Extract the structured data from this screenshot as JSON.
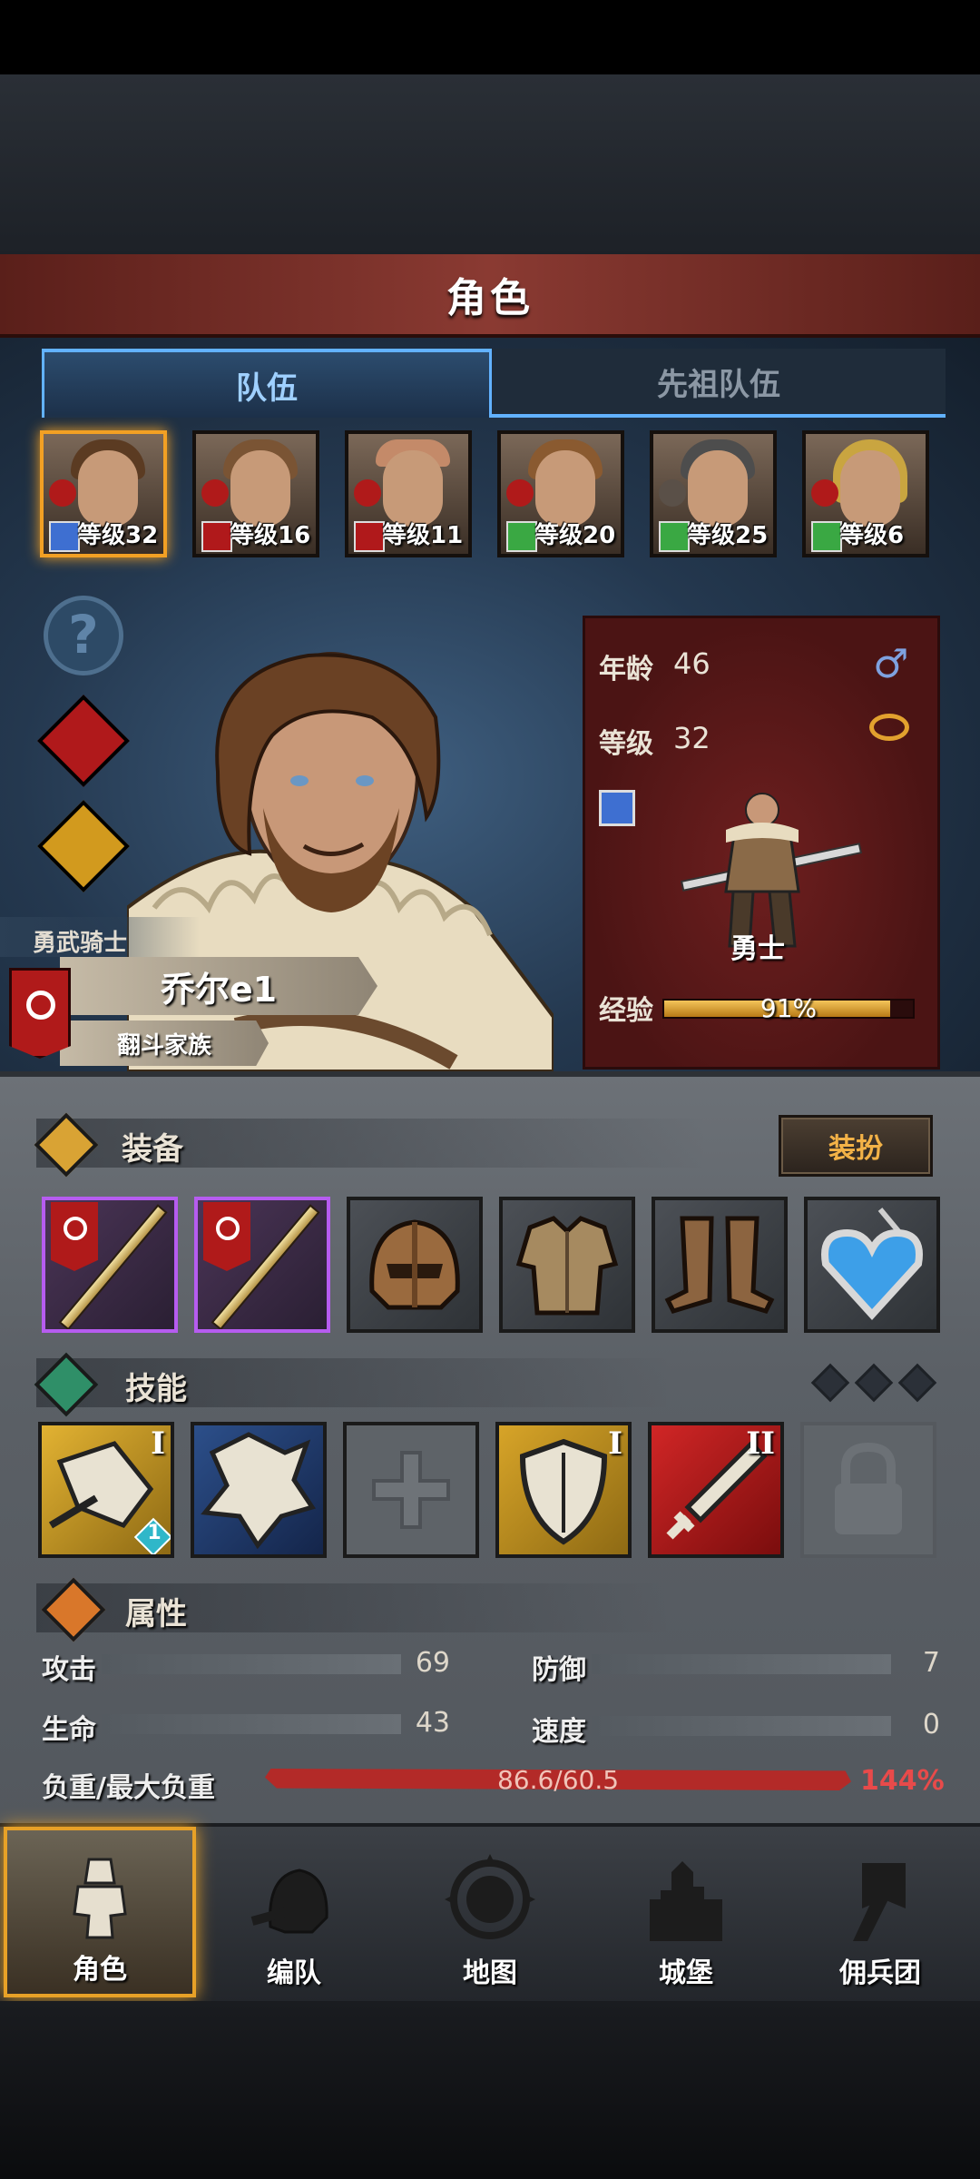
{
  "header": {
    "title": "角色"
  },
  "tabs": {
    "team": "队伍",
    "ancestor": "先祖队伍"
  },
  "party": [
    {
      "level": "等级32",
      "class_color": "#3e6fd1",
      "selected": true
    },
    {
      "level": "等级16",
      "class_color": "#b0191b"
    },
    {
      "level": "等级11",
      "class_color": "#b0191b"
    },
    {
      "level": "等级20",
      "class_color": "#3aa843"
    },
    {
      "level": "等级25",
      "class_color": "#3aa843"
    },
    {
      "level": "等级6",
      "class_color": "#3aa843"
    }
  ],
  "hero": {
    "title": "勇武骑士",
    "name": "乔尔e1",
    "family": "翻斗家族"
  },
  "stat_card": {
    "age_label": "年龄",
    "age": "46",
    "level_label": "等级",
    "level": "32",
    "class_name": "勇士",
    "exp_label": "经验",
    "exp_text": "91%",
    "exp_fraction": 0.91,
    "gender_icon": "male-icon",
    "ring_icon": "ring-icon"
  },
  "equipment": {
    "title": "装备",
    "dress_button": "装扮",
    "slots": [
      "sword-slot-1",
      "sword-slot-2",
      "helmet",
      "armor",
      "boots",
      "heart-amulet"
    ]
  },
  "skills": {
    "title": "技能",
    "items": [
      {
        "name": "charge-skill",
        "rank": "I",
        "badge": "1"
      },
      {
        "name": "fist-skill",
        "rank": ""
      },
      {
        "name": "empty-cross-skill",
        "rank": ""
      },
      {
        "name": "shield-skill",
        "rank": "I"
      },
      {
        "name": "sword-skill",
        "rank": "II"
      },
      {
        "name": "locked-skill",
        "rank": ""
      }
    ]
  },
  "attributes": {
    "title": "属性",
    "attack_label": "攻击",
    "attack": "69",
    "defense_label": "防御",
    "defense": "7",
    "life_label": "生命",
    "life": "43",
    "speed_label": "速度",
    "speed": "0",
    "weight_label": "负重/最大负重",
    "weight": "86.6/60.5",
    "weight_pct": "144%"
  },
  "nav": [
    {
      "label": "角色",
      "active": true
    },
    {
      "label": "编队"
    },
    {
      "label": "地图"
    },
    {
      "label": "城堡"
    },
    {
      "label": "佣兵团"
    }
  ],
  "colors": {
    "accent": "#f2a024",
    "tab_blue": "#62b2ff",
    "header_red": "#8a3a32"
  }
}
